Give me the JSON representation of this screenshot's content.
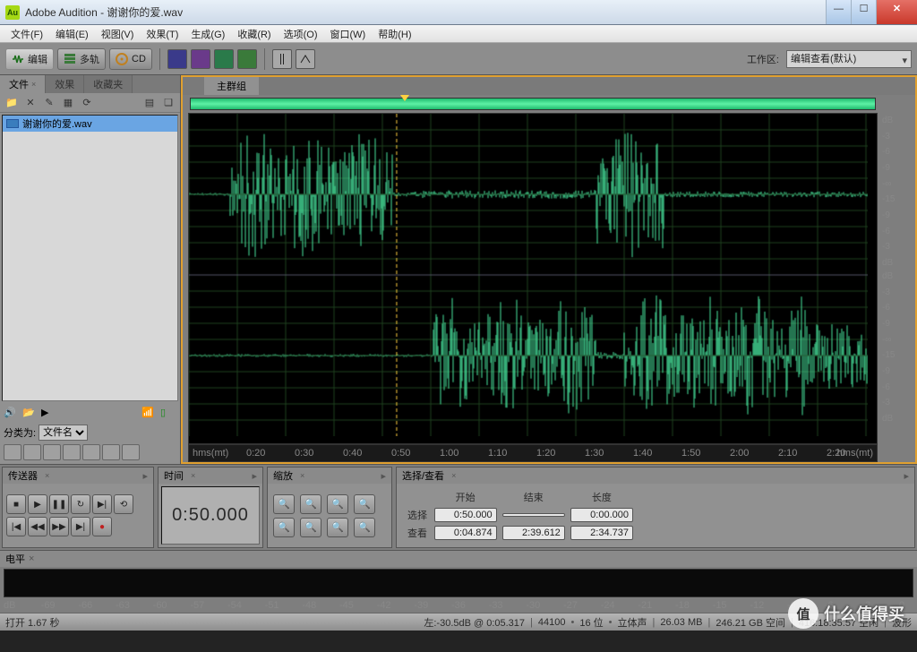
{
  "title": "Adobe Audition - 谢谢你的爱.wav",
  "app_icon": "Au",
  "menu": [
    "文件(F)",
    "编辑(E)",
    "视图(V)",
    "效果(T)",
    "生成(G)",
    "收藏(R)",
    "选项(O)",
    "窗口(W)",
    "帮助(H)"
  ],
  "toolbar": {
    "edit": "编辑",
    "multi": "多轨",
    "cd": "CD"
  },
  "workspace": {
    "label": "工作区:",
    "value": "编辑查看(默认)"
  },
  "left": {
    "tabs": [
      "文件",
      "效果",
      "收藏夹"
    ],
    "file": "谢谢你的爱.wav",
    "filter_label": "分类为:",
    "filter_value": "文件名"
  },
  "editor": {
    "tab": "主群组",
    "time_unit": "hms(mt)"
  },
  "db_ticks": [
    "dB",
    "-3",
    "-6",
    "-9",
    "-∞",
    "-15",
    "-9",
    "-6",
    "-3",
    "dB"
  ],
  "time_ticks": [
    "0:20",
    "0:30",
    "0:40",
    "0:50",
    "1:00",
    "1:10",
    "1:20",
    "1:30",
    "1:40",
    "1:50",
    "2:00",
    "2:10",
    "2:20"
  ],
  "panels": {
    "transport": "传送器",
    "time": "时间",
    "time_value": "0:50.000",
    "zoom": "缩放",
    "sel": "选择/查看",
    "sel_hdr": {
      "start": "开始",
      "end": "结束",
      "len": "长度"
    },
    "sel_rows": [
      {
        "lbl": "选择",
        "v": [
          "0:50.000",
          "",
          "0:00.000"
        ]
      },
      {
        "lbl": "查看",
        "v": [
          "0:04.874",
          "2:39.612",
          "2:34.737"
        ]
      }
    ]
  },
  "level": {
    "title": "电平",
    "ticks": [
      "dB",
      "-69",
      "-66",
      "-63",
      "-60",
      "-57",
      "-54",
      "-51",
      "-48",
      "-45",
      "-42",
      "-39",
      "-36",
      "-33",
      "-30",
      "-27",
      "-24",
      "-21",
      "-18",
      "-15",
      "-12",
      "-9",
      "-6",
      "-3",
      "0"
    ]
  },
  "status": {
    "open": "打开 1.67 秒",
    "db": "左:-30.5dB @ 0:05.317",
    "sr": "44100",
    "bit": "16 位",
    "ch": "立体声",
    "size": "26.03 MB",
    "free": "246.21 GB 空间",
    "dur": "416:18:35.57 空闲",
    "mode": "波形"
  },
  "watermark": {
    "badge": "值",
    "text": "什么值得买"
  }
}
